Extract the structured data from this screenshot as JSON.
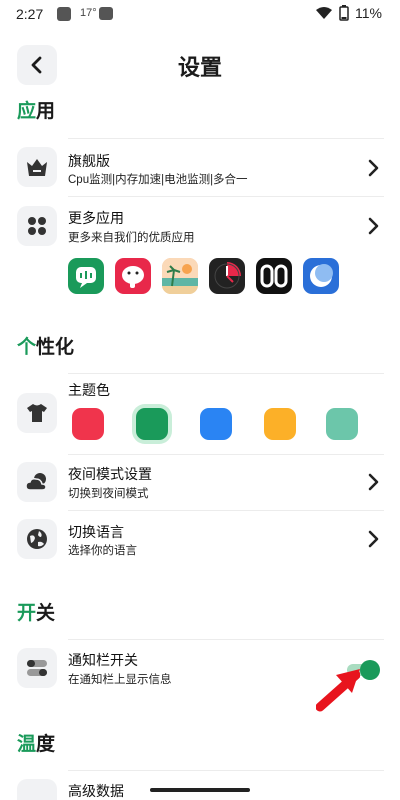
{
  "status_bar": {
    "time": "2:27",
    "temperature": "17°",
    "battery": "11%"
  },
  "header": {
    "title": "设置"
  },
  "sections": {
    "apps": {
      "accent": "应",
      "rest": "用"
    },
    "personalize": {
      "accent": "个",
      "rest": "性化"
    },
    "switches": {
      "accent": "开",
      "rest": "关"
    },
    "temperature": {
      "accent": "温",
      "rest": "度"
    }
  },
  "apps": {
    "flagship": {
      "title": "旗舰版",
      "subtitle": "Cpu监测|内存加速|电池监测|多合一"
    },
    "more_apps": {
      "title": "更多应用",
      "subtitle": "更多来自我们的优质应用"
    },
    "icons": [
      "chat-app-icon",
      "elephant-app-icon",
      "beach-app-icon",
      "clock-app-icon",
      "digits-app-icon",
      "moon-app-icon"
    ]
  },
  "personalize": {
    "theme": {
      "title": "主题色"
    },
    "swatches": [
      "#f0344c",
      "#1a9a5a",
      "#2a84f3",
      "#fcb028",
      "#6cc6aa"
    ],
    "selected_swatch": 1,
    "night_mode": {
      "title": "夜间模式设置",
      "subtitle": "切换到夜间模式"
    },
    "language": {
      "title": "切换语言",
      "subtitle": "选择你的语言"
    }
  },
  "switches": {
    "notification": {
      "title": "通知栏开关",
      "subtitle": "在通知栏上显示信息",
      "enabled": true
    }
  },
  "temperature_section": {
    "partial_row": "高级数据"
  },
  "colors": {
    "accent": "#1a9a5a",
    "arrow": "#e8141d"
  }
}
